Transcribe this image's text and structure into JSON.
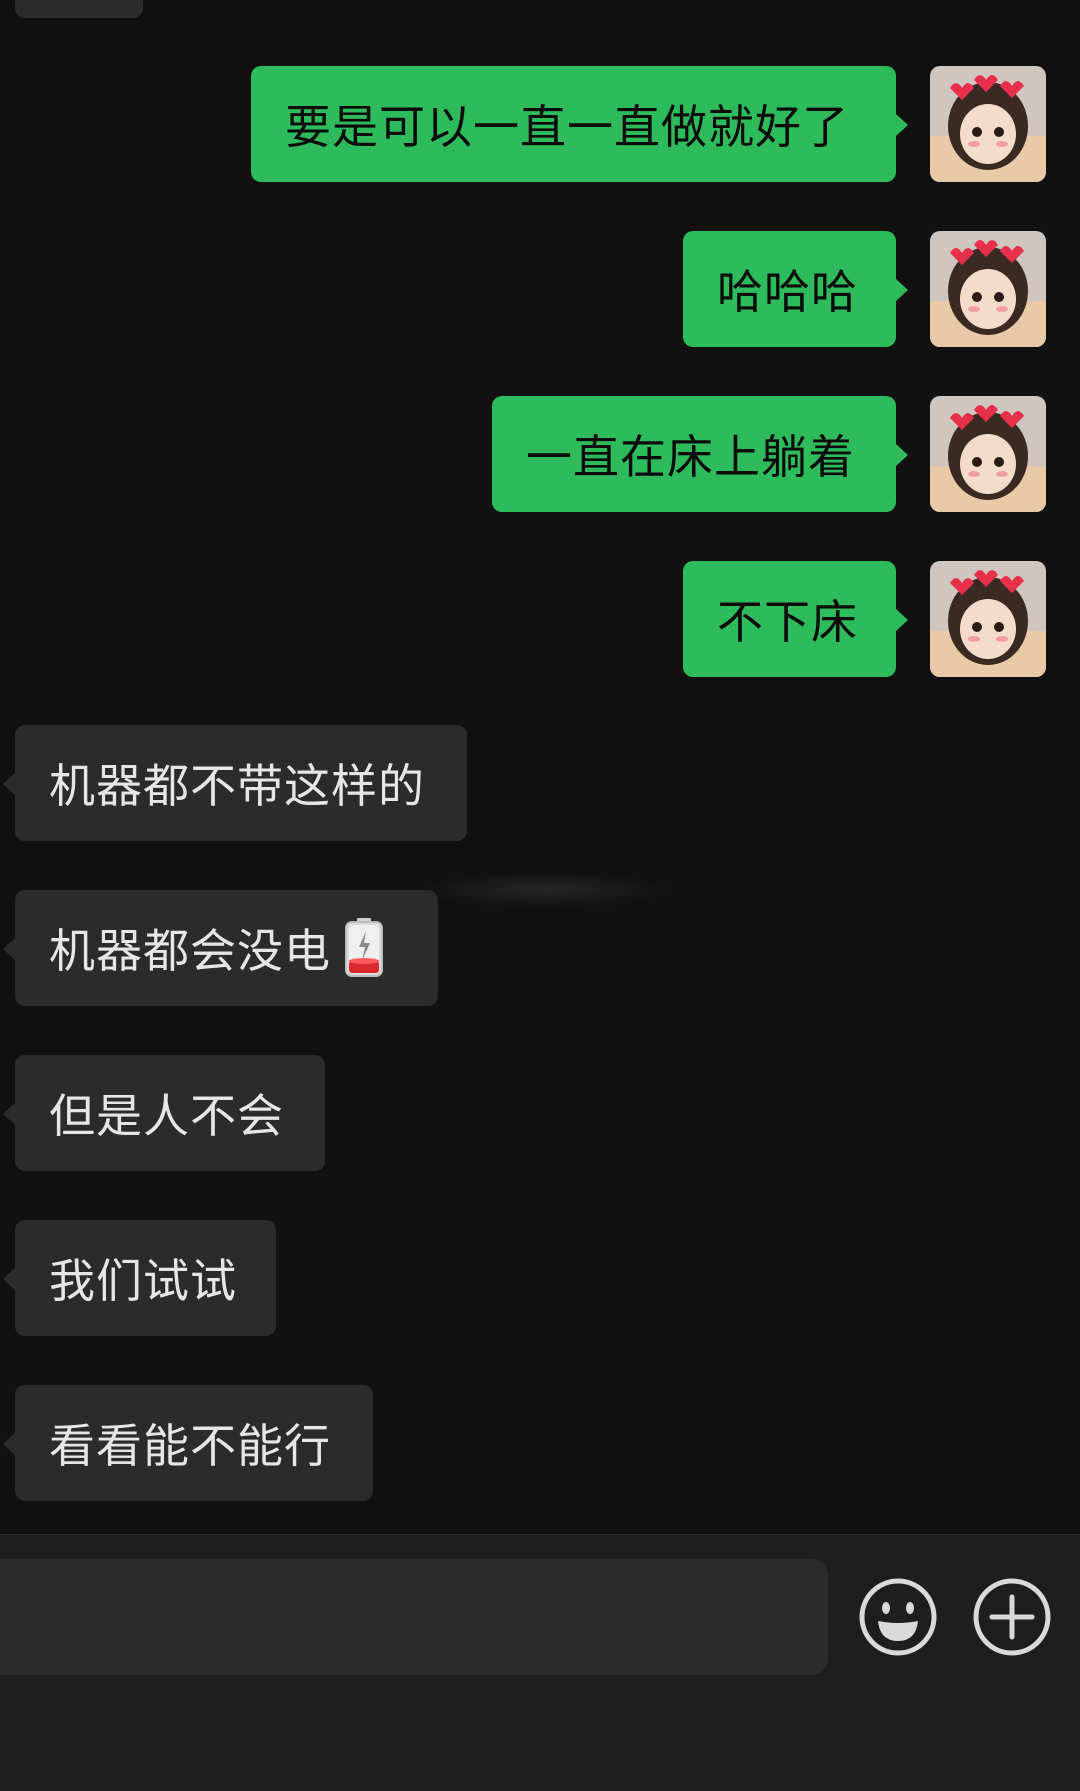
{
  "messages": [
    {
      "side": "sent",
      "text": "要是可以一直一直做就好了"
    },
    {
      "side": "sent",
      "text": "哈哈哈"
    },
    {
      "side": "sent",
      "text": "一直在床上躺着"
    },
    {
      "side": "sent",
      "text": "不下床"
    },
    {
      "side": "received",
      "text": "机器都不带这样的"
    },
    {
      "side": "received",
      "text": "机器都会没电",
      "trailing_icon": "low-battery-icon"
    },
    {
      "side": "received",
      "text": "但是人不会"
    },
    {
      "side": "received",
      "text": "我们试试"
    },
    {
      "side": "received",
      "text": "看看能不能行"
    }
  ],
  "input": {
    "value": "",
    "emoji_icon": "emoji-icon",
    "plus_icon": "plus-icon"
  },
  "colors": {
    "background": "#111111",
    "sent_bubble": "#2ebb5c",
    "received_bubble": "#2b2b2b",
    "input_bar": "#1e1e1e"
  }
}
